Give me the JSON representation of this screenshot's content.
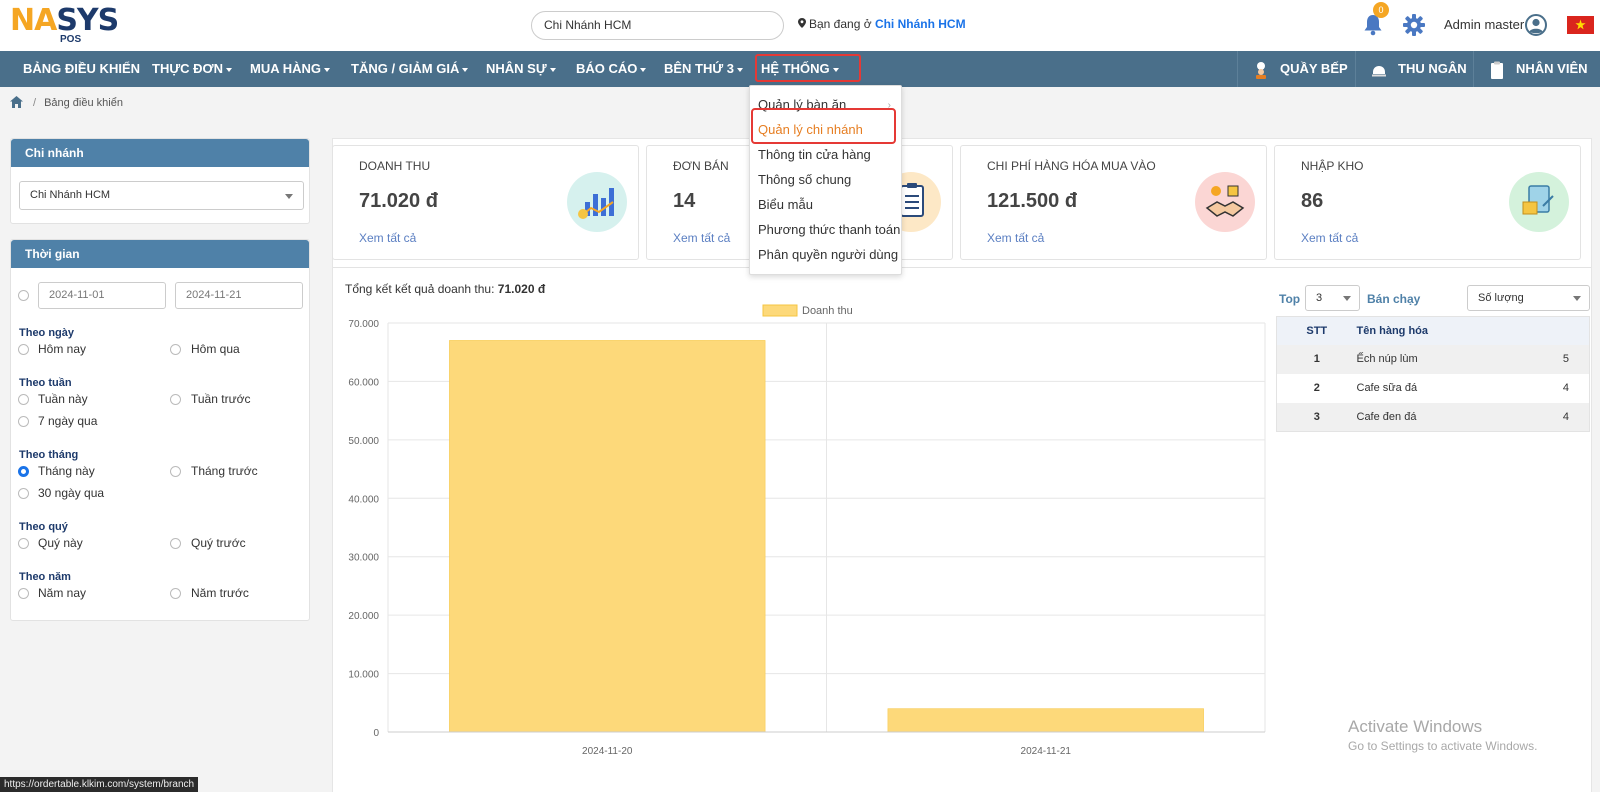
{
  "header": {
    "logo_na": "NA",
    "logo_sys": "SYS",
    "logo_pos": "POS",
    "branch_search_value": "Chi Nhánh HCM",
    "location_prefix": "Bạn đang ở",
    "location_branch": "Chi Nhánh HCM",
    "notification_count": "0",
    "admin_name": "Admin master"
  },
  "nav": {
    "items": [
      {
        "label": "BẢNG ĐIỀU KHIỂN"
      },
      {
        "label": "THỰC ĐƠN"
      },
      {
        "label": "MUA HÀNG"
      },
      {
        "label": "TĂNG / GIẢM GIÁ"
      },
      {
        "label": "NHÂN SỰ"
      },
      {
        "label": "BÁO CÁO"
      },
      {
        "label": "BÊN THỨ 3"
      },
      {
        "label": "HỆ THỐNG"
      }
    ],
    "right": [
      {
        "label": "QUẦY BẾP"
      },
      {
        "label": "THU NGÂN"
      },
      {
        "label": "NHÂN VIÊN"
      }
    ]
  },
  "system_menu": {
    "items": [
      "Quản lý bàn ăn",
      "Quản lý chi nhánh",
      "Thông tin cửa hàng",
      "Thông số chung",
      "Biểu mẫu",
      "Phương thức thanh toán",
      "Phân quyền người dùng"
    ],
    "active_index": 1
  },
  "breadcrumb": {
    "current": "Bảng điều khiển"
  },
  "branch_panel": {
    "title": "Chi nhánh",
    "selected": "Chi Nhánh HCM"
  },
  "time_panel": {
    "title": "Thời gian",
    "date_from": "2024-11-01",
    "date_to": "2024-11-21",
    "groups": [
      {
        "label": "Theo ngày",
        "options": [
          "Hôm nay",
          "Hôm qua"
        ]
      },
      {
        "label": "Theo tuần",
        "options": [
          "Tuần này",
          "Tuần trước",
          "7 ngày qua"
        ]
      },
      {
        "label": "Theo tháng",
        "options": [
          "Tháng này",
          "Tháng trước",
          "30 ngày qua"
        ]
      },
      {
        "label": "Theo quý",
        "options": [
          "Quý này",
          "Quý trước"
        ]
      },
      {
        "label": "Theo năm",
        "options": [
          "Năm nay",
          "Năm trước"
        ]
      }
    ],
    "selected": "Tháng này"
  },
  "cards": [
    {
      "title": "DOANH THU",
      "value": "71.020 đ",
      "link": "Xem tất cả",
      "icon": "revenue-chart-icon",
      "color": "#d6f1ee"
    },
    {
      "title": "ĐƠN BÁN",
      "value": "14",
      "link": "Xem tất cả",
      "icon": "clipboard-icon",
      "color": "#fde8c6"
    },
    {
      "title": "CHI PHÍ HÀNG HÓA MUA VÀO",
      "value": "121.500 đ",
      "link": "Xem tất cả",
      "icon": "handshake-icon",
      "color": "#fbd6d4"
    },
    {
      "title": "NHẬP KHO",
      "value": "86",
      "link": "Xem tất cả",
      "icon": "warehouse-import-icon",
      "color": "#d4f2dc"
    }
  ],
  "revenue_summary": {
    "prefix": "Tổng kết kết quả doanh thu:",
    "value": "71.020 đ"
  },
  "chart_data": {
    "type": "bar",
    "categories": [
      "2024-11-20",
      "2024-11-21"
    ],
    "series": [
      {
        "name": "Doanh thu",
        "values": [
          67020,
          4000
        ],
        "color": "#fdd97a"
      }
    ],
    "ylim": [
      0,
      70000
    ],
    "yticks": [
      "0",
      "10.000",
      "20.000",
      "30.000",
      "40.000",
      "50.000",
      "60.000",
      "70.000"
    ],
    "ytick_values": [
      0,
      10000,
      20000,
      30000,
      40000,
      50000,
      60000,
      70000
    ],
    "legend": "top",
    "grid": true
  },
  "top_products": {
    "top_label": "Top",
    "top_value": "3",
    "best_label": "Bán chạy",
    "sort_value": "Số lượng",
    "headers": {
      "stt": "STT",
      "name": "Tên hàng hóa"
    },
    "rows": [
      {
        "stt": "1",
        "name": "Ếch núp lùm",
        "qty": "5"
      },
      {
        "stt": "2",
        "name": "Cafe sữa đá",
        "qty": "4"
      },
      {
        "stt": "3",
        "name": "Cafe đen đá",
        "qty": "4"
      }
    ]
  },
  "watermark": {
    "line1": "Activate Windows",
    "line2": "Go to Settings to activate Windows."
  },
  "status_url": "https://ordertable.klkim.com/system/branch"
}
